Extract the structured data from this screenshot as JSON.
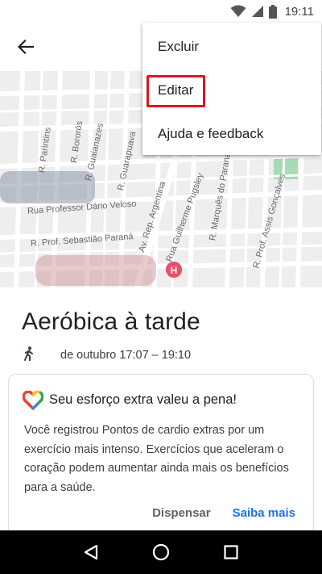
{
  "status_bar": {
    "time": "19:11",
    "icons": [
      "wifi-icon",
      "signal-icon",
      "battery-icon"
    ]
  },
  "app_bar": {
    "back_icon": "arrow-back-icon"
  },
  "map": {
    "street_labels": [
      "R. Parintins",
      "R. Bororós",
      "R. Guaianazes",
      "R. Guarapuava",
      "Av. Rep. Argentina",
      "Rua Guilherme Pugsley",
      "R. Marquês do Paraná",
      "R. Prof. Assis Gonçalves",
      "Rua Professor Dário Veloso",
      "R. Prof. Sebastião Paraná"
    ],
    "hospital_marker": "H"
  },
  "menu": {
    "items": [
      "Excluir",
      "Editar",
      "Ajuda e feedback"
    ],
    "highlighted_index": 1
  },
  "activity": {
    "title": "Aeróbica à tarde",
    "activity_icon": "walking-figure-icon",
    "time_range": "de outubro 17:07 – 19:10"
  },
  "card": {
    "icon": "google-fit-heart-icon",
    "title": "Seu esforço extra valeu a pena!",
    "body": "Você registrou Pontos de cardio extras por um exercício mais intenso. Exercícios que aceleram o coração podem aumentar ainda mais os benefícios para a saúde.",
    "dismiss_label": "Dispensar",
    "learn_more_label": "Saiba mais"
  },
  "nav_bar": {
    "icons": [
      "nav-back-icon",
      "nav-home-icon",
      "nav-recents-icon"
    ]
  },
  "colors": {
    "highlight": "#e0141e",
    "link": "#1a73e8",
    "map_background": "#eeeeee",
    "park": "#a8dab5"
  }
}
